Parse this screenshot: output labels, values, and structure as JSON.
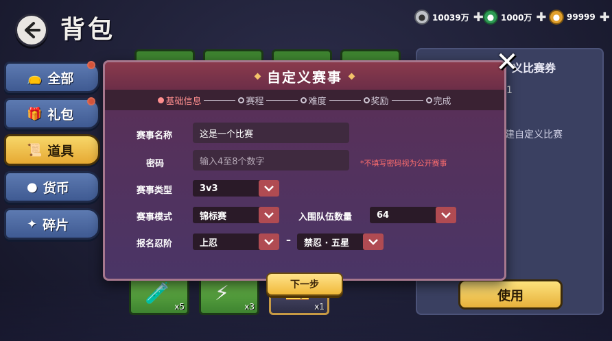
{
  "header": {
    "title": "背包",
    "currencies": [
      {
        "icon": "silver-coin-icon",
        "value": "10039万"
      },
      {
        "icon": "green-gem-icon",
        "value": "1000万"
      },
      {
        "icon": "gold-gem-icon",
        "value": "99999"
      }
    ]
  },
  "sidebar": {
    "items": [
      {
        "label": "全部",
        "icon": "bag-icon"
      },
      {
        "label": "礼包",
        "icon": "gift-icon"
      },
      {
        "label": "道具",
        "icon": "scroll-icon"
      },
      {
        "label": "货币",
        "icon": "coin-icon"
      },
      {
        "label": "碎片",
        "icon": "shard-icon"
      }
    ]
  },
  "right_panel": {
    "title": "义比赛券",
    "count": "1",
    "desc": "建自定义比赛",
    "use_label": "使用"
  },
  "items": [
    {
      "count": "x5"
    },
    {
      "count": "x3"
    },
    {
      "count": "x1"
    }
  ],
  "modal": {
    "title": "自定义赛事",
    "steps": [
      "基础信息",
      "赛程",
      "难度",
      "奖励",
      "完成"
    ],
    "name_label": "赛事名称",
    "name_value": "这是一个比赛",
    "password_label": "密码",
    "password_placeholder": "输入4至8个数字",
    "password_hint": "*不填写密码视为公开赛事",
    "type_label": "赛事类型",
    "type_value": "3v3",
    "mode_label": "赛事模式",
    "mode_value": "锦标赛",
    "teams_label": "入围队伍数量",
    "teams_value": "64",
    "rank_label": "报名忍阶",
    "rank_min": "上忍",
    "rank_sep": "–",
    "rank_max": "禁忍 · 五星",
    "next_label": "下一步"
  },
  "colors": {
    "accent_gold": "#f0b93a",
    "active_step": "#ff8f8f",
    "hint_red": "#ff6e6e"
  }
}
